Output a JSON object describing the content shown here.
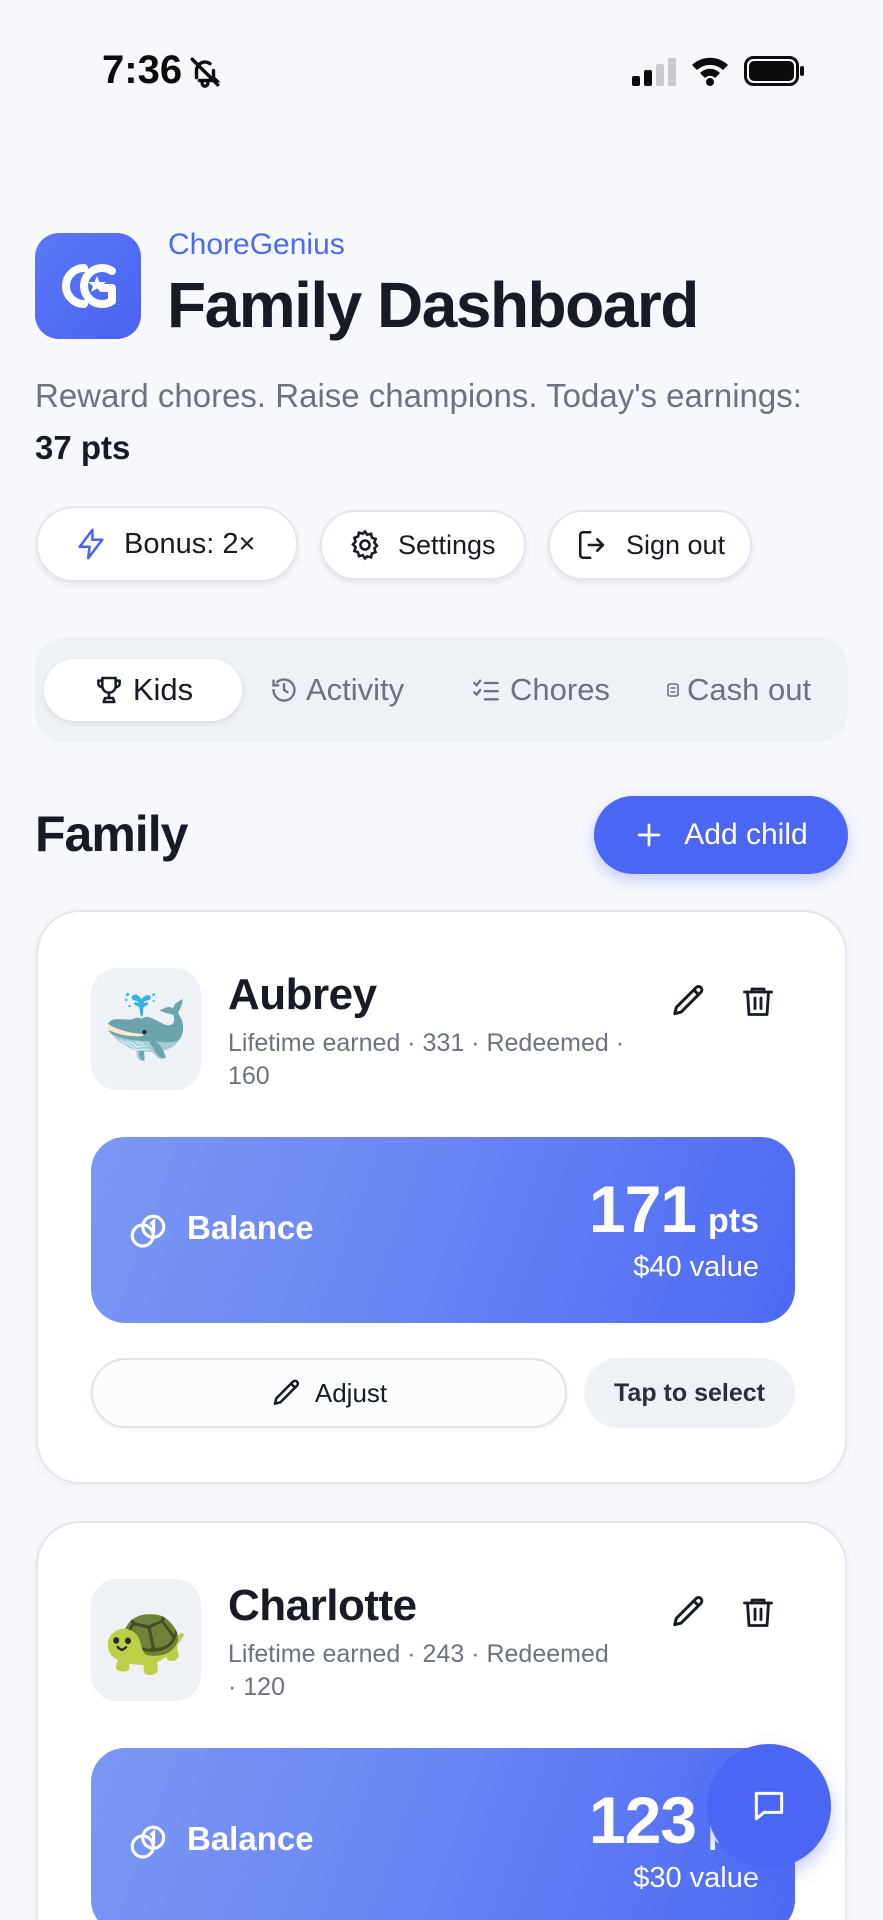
{
  "status_bar": {
    "time": "7:36"
  },
  "header": {
    "app_name": "ChoreGenius",
    "title": "Family Dashboard",
    "subtitle_text": "Reward chores. Raise champions. Today's earnings:",
    "earnings": "37 pts"
  },
  "actions": {
    "bonus_label": "Bonus: 2×",
    "settings_label": "Settings",
    "signout_label": "Sign out"
  },
  "tabs": [
    {
      "label": "Kids",
      "icon": "trophy-icon",
      "active": true
    },
    {
      "label": "Activity",
      "icon": "history-icon",
      "active": false
    },
    {
      "label": "Chores",
      "icon": "checklist-icon",
      "active": false
    },
    {
      "label": "Cash out",
      "icon": "cash-icon",
      "active": false
    }
  ],
  "family": {
    "title": "Family",
    "add_child_label": "Add child",
    "children": [
      {
        "name": "Aubrey",
        "avatar": "🐳",
        "meta_line1": "Lifetime earned · 331 · Redeemed ·",
        "meta_line2": "160",
        "balance_label": "Balance",
        "balance_points": "171",
        "balance_unit": "pts",
        "balance_value": "$40 value",
        "adjust_label": "Adjust",
        "select_label": "Tap to select"
      },
      {
        "name": "Charlotte",
        "avatar": "🐢",
        "meta_line1": "Lifetime earned · 243 · Redeemed",
        "meta_line2": "· 120",
        "balance_label": "Balance",
        "balance_points": "123",
        "balance_unit": "pts",
        "balance_value": "$30 value"
      }
    ]
  },
  "colors": {
    "accent": "#4b66f5",
    "background": "#f6f8fc",
    "text_primary": "#161b26",
    "text_secondary": "#6b7280"
  }
}
